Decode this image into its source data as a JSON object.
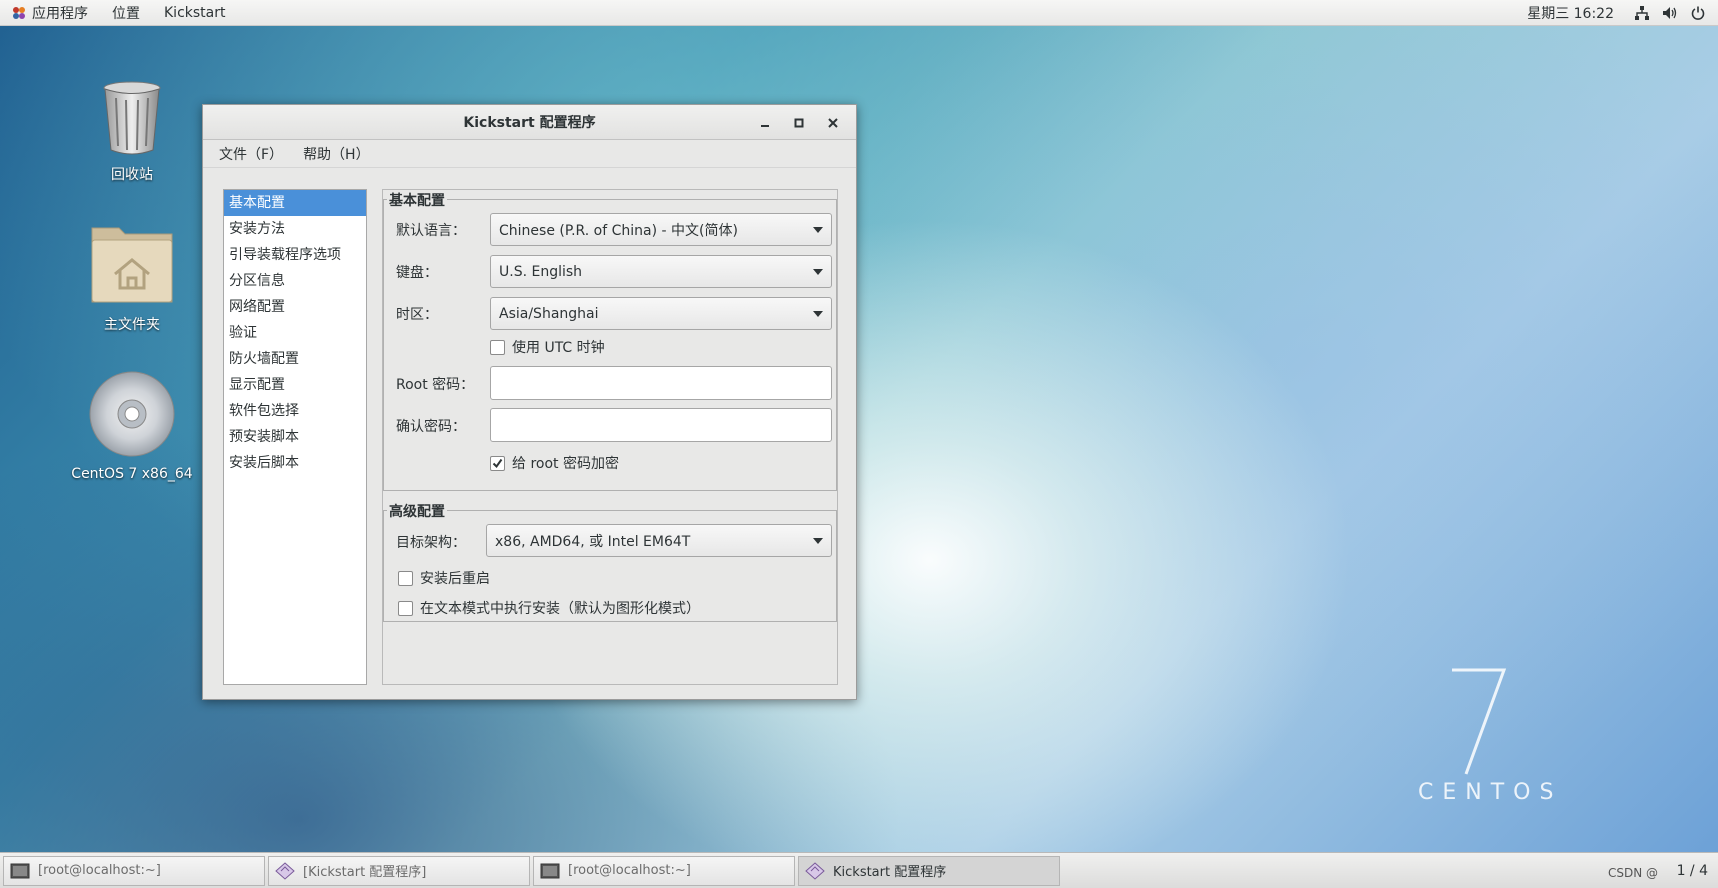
{
  "topbar": {
    "apps_label": "应用程序",
    "places_label": "位置",
    "app_name": "Kickstart",
    "clock": "星期三 16:22"
  },
  "desktop": {
    "icons": [
      {
        "label": "回收站",
        "icon": "trash-icon"
      },
      {
        "label": "主文件夹",
        "icon": "home-folder-icon"
      },
      {
        "label": "CentOS 7 x86_64",
        "icon": "disc-icon"
      }
    ],
    "brand_number": "7",
    "brand_text": "CENTOS"
  },
  "window": {
    "title": "Kickstart 配置程序",
    "menu": [
      "文件（F）",
      "帮助（H）"
    ],
    "nav_items": [
      "基本配置",
      "安装方法",
      "引导装载程序选项",
      "分区信息",
      "网络配置",
      "验证",
      "防火墙配置",
      "显示配置",
      "软件包选择",
      "预安装脚本",
      "安装后脚本"
    ],
    "selected_nav": "基本配置",
    "basic": {
      "frame_title": "基本配置",
      "language_label": "默认语言：",
      "language_value": "Chinese (P.R. of China) - 中文(简体)",
      "keyboard_label": "键盘：",
      "keyboard_value": "U.S. English",
      "timezone_label": "时区：",
      "timezone_value": "Asia/Shanghai",
      "utc_label": "使用  UTC 时钟",
      "utc_checked": false,
      "root_pw_label": "Root 密码：",
      "root_pw_value": "",
      "confirm_pw_label": "确认密码：",
      "confirm_pw_value": "",
      "encrypt_label": "给  root 密码加密",
      "encrypt_checked": true
    },
    "advanced": {
      "frame_title": "高级配置",
      "arch_label": "目标架构：",
      "arch_value": "x86, AMD64, 或  Intel EM64T",
      "reboot_label": "安装后重启",
      "reboot_checked": false,
      "text_mode_label": "在文本模式中执行安装（默认为图形化模式）",
      "text_mode_checked": false
    }
  },
  "taskbar": {
    "tasks": [
      {
        "label": "[root@localhost:~]",
        "icon": "terminal-icon",
        "active": false
      },
      {
        "label": "[Kickstart 配置程序]",
        "icon": "kickstart-icon",
        "active": false
      },
      {
        "label": "[root@localhost:~]",
        "icon": "terminal-icon",
        "active": false
      },
      {
        "label": "Kickstart 配置程序",
        "icon": "kickstart-icon",
        "active": true
      }
    ],
    "pager": "1 / 4",
    "watermark": "CSDN @"
  }
}
